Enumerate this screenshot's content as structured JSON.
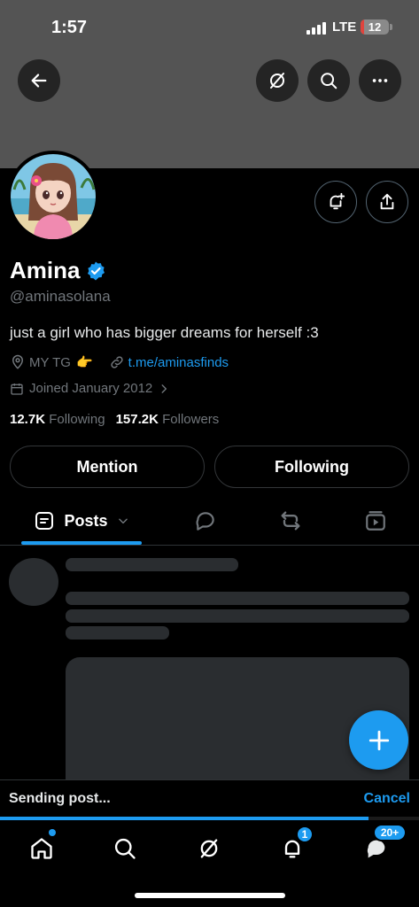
{
  "status_bar": {
    "time": "1:57",
    "network": "LTE",
    "battery_level": "12",
    "battery_fraction": 0.12
  },
  "profile": {
    "name": "Amina",
    "handle": "@aminasolana",
    "bio": "just a girl who has bigger dreams for herself :3",
    "location": "MY TG",
    "location_emoji": "👉",
    "website": "t.me/aminasfinds",
    "joined": "Joined January 2012",
    "following_count": "12.7K",
    "following_label": "Following",
    "followers_count": "157.2K",
    "followers_label": "Followers",
    "verified": true
  },
  "actions": {
    "mention_label": "Mention",
    "following_label": "Following"
  },
  "tabs": [
    {
      "label": "Posts",
      "icon": "posts-icon",
      "active": true
    },
    {
      "icon": "reply-icon"
    },
    {
      "icon": "repost-icon"
    },
    {
      "icon": "media-icon"
    }
  ],
  "sending": {
    "text": "Sending post...",
    "cancel_label": "Cancel",
    "progress": 0.88
  },
  "bottom_nav": {
    "notifications_badge": "1",
    "messages_badge": "20+"
  },
  "colors": {
    "accent": "#1d9bf0",
    "banner": "#545454",
    "background": "#000000"
  }
}
